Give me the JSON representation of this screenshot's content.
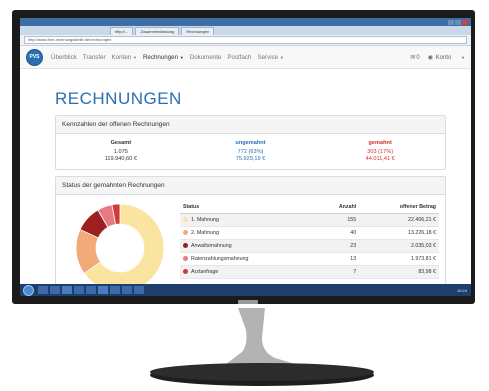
{
  "browser": {
    "tabs": [
      "http://...",
      "Zusammenfassung",
      "Rechnungen"
    ],
    "address": "http://www.ihre-rechnungsstelle.de/rechnungen"
  },
  "app": {
    "logo_text": "PVS",
    "nav": [
      {
        "label": "Überblick",
        "caret": false
      },
      {
        "label": "Transfer",
        "caret": false
      },
      {
        "label": "Konten",
        "caret": true
      },
      {
        "label": "Rechnungen",
        "caret": true,
        "active": true
      },
      {
        "label": "Dokumente",
        "caret": false
      },
      {
        "label": "Postfach",
        "caret": false
      },
      {
        "label": "Service",
        "caret": true
      }
    ],
    "mail_count": "0",
    "account_label": "Konto"
  },
  "page": {
    "title": "RECHNUNGEN"
  },
  "kpi": {
    "heading": "Kennzahlen der offenen Rechnungen",
    "total": {
      "label": "Gesamt",
      "count": "1.075",
      "amount": "119.940,60 €"
    },
    "ungemahnt": {
      "label": "ungemahnt",
      "count": "772 (63%)",
      "amount": "75.929,19 €"
    },
    "gemahnt": {
      "label": "gemahnt",
      "count": "303 (17%)",
      "amount": "44.011,41 €"
    }
  },
  "dunning": {
    "heading": "Status der gemahnten Rechnungen",
    "columns": {
      "status": "Status",
      "count": "Anzahl",
      "amount": "offener Betrag"
    },
    "rows": [
      {
        "status": "1. Mahnung",
        "count": "155",
        "amount": "22.406,21 €",
        "color": "#fbe4a0"
      },
      {
        "status": "2. Mahnung",
        "count": "40",
        "amount": "13.226,18 €",
        "color": "#f3a978"
      },
      {
        "status": "Anwaltsmahnung",
        "count": "23",
        "amount": "2.035,03 €",
        "color": "#9c2020"
      },
      {
        "status": "Ratenzahlungsmahnung",
        "count": "13",
        "amount": "1.973,81 €",
        "color": "#e87a84"
      },
      {
        "status": "Arztanfrage",
        "count": "7",
        "amount": "83,98 €",
        "color": "#d33a3a"
      }
    ]
  },
  "taskbar": {
    "clock": "10:24"
  },
  "colors": {
    "accent": "#2a6fb3",
    "gemahnt": "#d0312d",
    "taskbar": "#1e3f6e"
  }
}
